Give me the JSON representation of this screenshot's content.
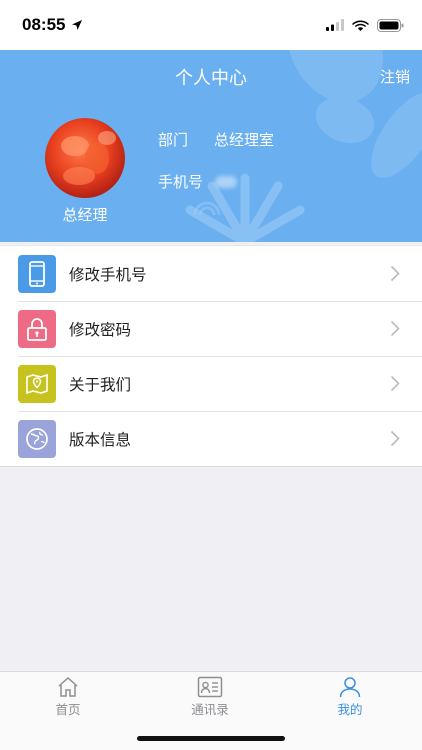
{
  "status_bar": {
    "time": "08:55"
  },
  "header": {
    "title": "个人中心",
    "logout_label": "注销",
    "role": "总经理",
    "department_label": "部门",
    "department_value": "总经理室",
    "phone_label": "手机号"
  },
  "menu": {
    "items": [
      {
        "label": "修改手机号",
        "icon": "phone-icon",
        "color": "#4a9ae8"
      },
      {
        "label": "修改密码",
        "icon": "lock-icon",
        "color": "#ee6b85"
      },
      {
        "label": "关于我们",
        "icon": "map-pin-icon",
        "color": "#c6c21e"
      },
      {
        "label": "版本信息",
        "icon": "globe-icon",
        "color": "#9aa3da"
      }
    ]
  },
  "tabbar": {
    "tabs": [
      {
        "label": "首页",
        "icon": "home-icon"
      },
      {
        "label": "通讯录",
        "icon": "contacts-icon"
      },
      {
        "label": "我的",
        "icon": "person-icon",
        "active": true
      }
    ]
  },
  "colors": {
    "header_bg": "#6aaff0",
    "accent": "#3a8fe5"
  }
}
